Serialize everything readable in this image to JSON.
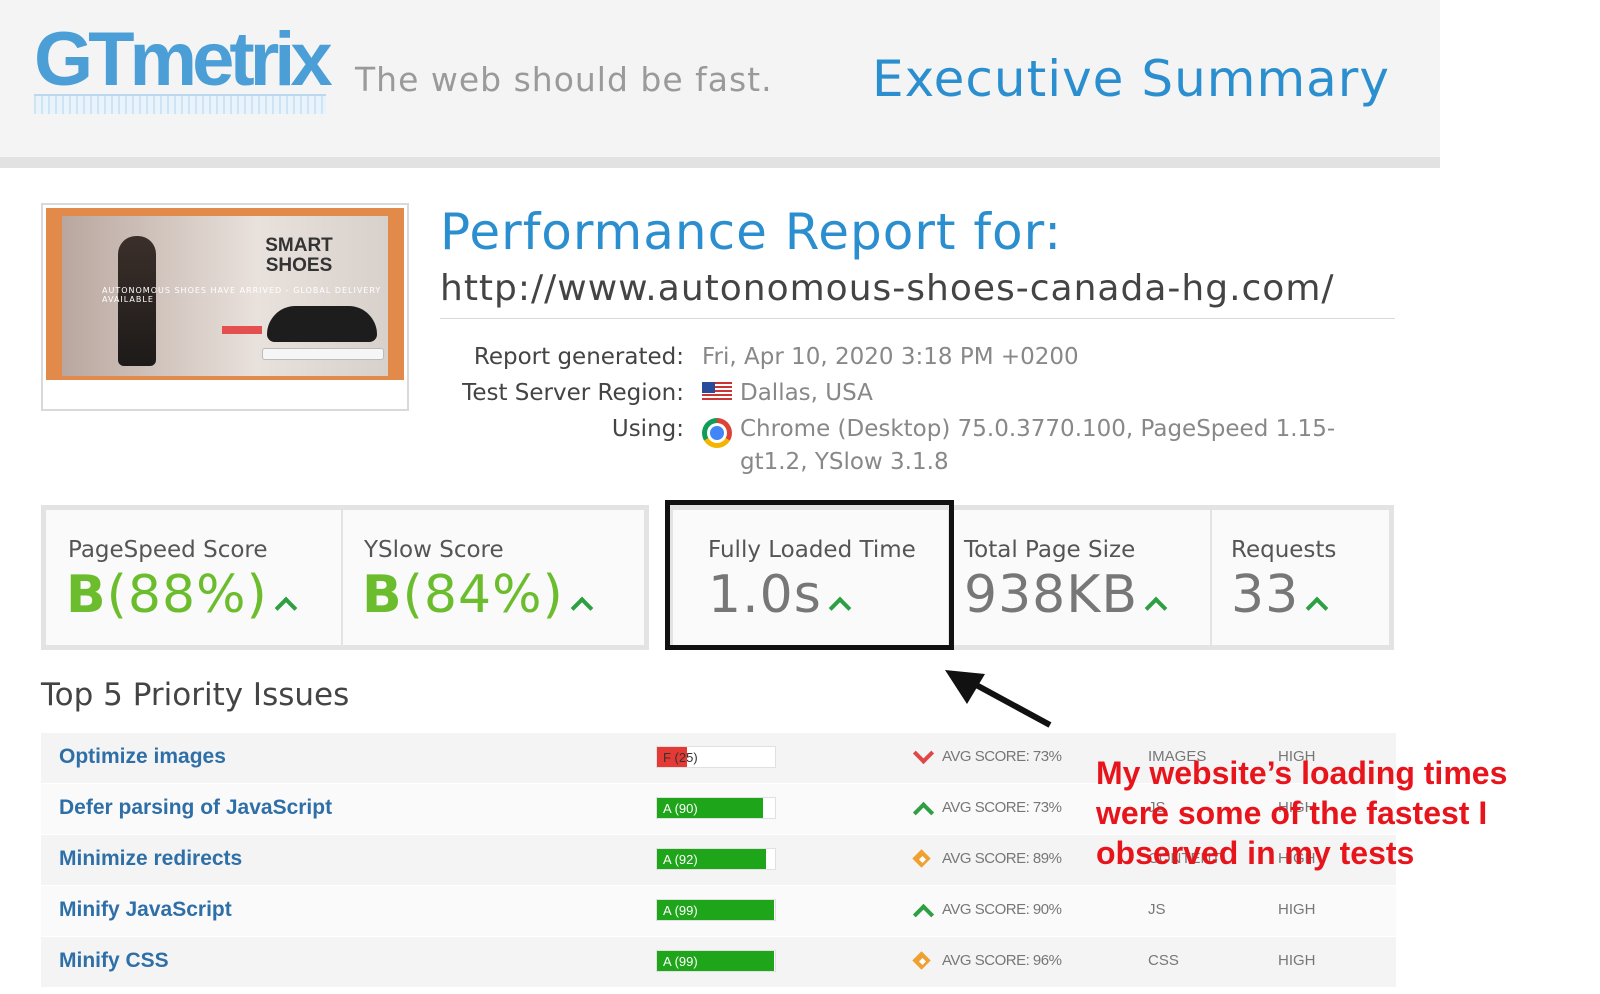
{
  "header": {
    "logo_text": "GTmetrix",
    "tagline": "The web should be fast.",
    "title": "Executive Summary"
  },
  "thumbnail": {
    "title": "SMART SHOES",
    "subtitle": "AUTONOMOUS SHOES HAVE ARRIVED - GLOBAL DELIVERY AVAILABLE"
  },
  "report": {
    "heading": "Performance Report for:",
    "url": "http://www.autonomous-shoes-canada-hg.com/",
    "generated_label": "Report generated:",
    "generated_value": "Fri, Apr 10, 2020 3:18 PM +0200",
    "region_label": "Test Server Region:",
    "region_value": "Dallas, USA",
    "using_label": "Using:",
    "using_value_line1": "Chrome (Desktop) 75.0.3770.100, PageSpeed 1.15-",
    "using_value_line2": "gt1.2, YSlow 3.1.8"
  },
  "scores": {
    "pagespeed_label": "PageSpeed Score",
    "pagespeed_grade": "B",
    "pagespeed_pct": "(88%)",
    "yslow_label": "YSlow Score",
    "yslow_grade": "B",
    "yslow_pct": "(84%)",
    "loaded_label": "Fully Loaded Time",
    "loaded_value": "1.0s",
    "size_label": "Total Page Size",
    "size_value": "938KB",
    "requests_label": "Requests",
    "requests_value": "33"
  },
  "issues": {
    "title": "Top 5 Priority Issues",
    "rows": [
      {
        "name": "Optimize images",
        "bar_label": "F (25)",
        "score": 25,
        "bar_color": "#e53935",
        "trend": "down",
        "avg": "AVG SCORE: 73%",
        "category": "IMAGES",
        "priority": "HIGH"
      },
      {
        "name": "Defer parsing of JavaScript",
        "bar_label": "A (90)",
        "score": 90,
        "bar_color": "#1ea51a",
        "trend": "up",
        "avg": "AVG SCORE: 73%",
        "category": "JS",
        "priority": "HIGH"
      },
      {
        "name": "Minimize redirects",
        "bar_label": "A (92)",
        "score": 92,
        "bar_color": "#1ea51a",
        "trend": "diamond",
        "avg": "AVG SCORE: 89%",
        "category": "CONTENT",
        "priority": "HIGH"
      },
      {
        "name": "Minify JavaScript",
        "bar_label": "A (99)",
        "score": 99,
        "bar_color": "#1ea51a",
        "trend": "up",
        "avg": "AVG SCORE: 90%",
        "category": "JS",
        "priority": "HIGH"
      },
      {
        "name": "Minify CSS",
        "bar_label": "A (99)",
        "score": 99,
        "bar_color": "#1ea51a",
        "trend": "diamond",
        "avg": "AVG SCORE: 96%",
        "category": "CSS",
        "priority": "HIGH"
      }
    ]
  },
  "annotation": {
    "text": "My website’s loading times were some of the fastest I observed in my tests",
    "color": "#e8141b"
  }
}
